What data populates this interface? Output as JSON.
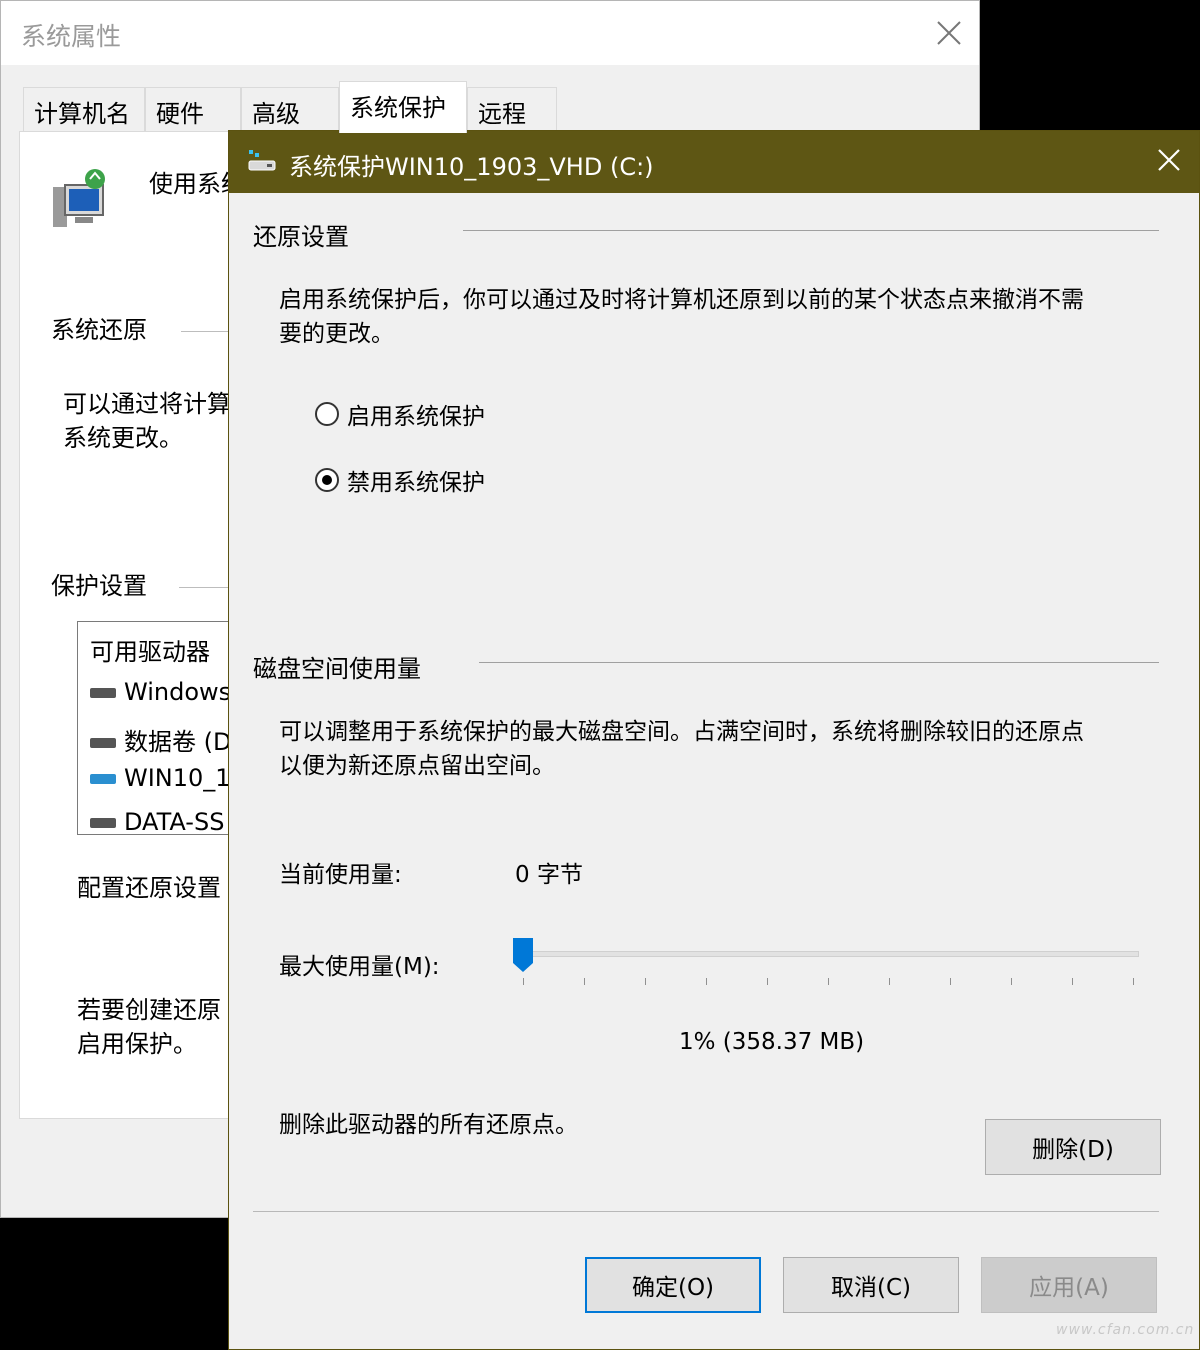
{
  "back_window": {
    "title": "系统属性",
    "tabs": [
      "计算机名",
      "硬件",
      "高级",
      "系统保护",
      "远程"
    ],
    "active_tab": "系统保护",
    "intro_text": "使用系统",
    "system_restore_label": "系统还原",
    "system_restore_desc": "可以通过将计算\n系统更改。",
    "protection_settings_label": "保护设置",
    "drive_list": {
      "header": "可用驱动器",
      "items": [
        "Windows",
        "数据卷 (D",
        "WIN10_1",
        "DATA-SS"
      ]
    },
    "configure_text": "配置还原设置",
    "create_text": "若要创建还原\n启用保护。"
  },
  "dialog": {
    "title": "系统保护WIN10_1903_VHD (C:)",
    "restore_settings": {
      "label": "还原设置",
      "description": "启用系统保护后，你可以通过及时将计算机还原到以前的某个状态点来撤消不需\n要的更改。",
      "options": [
        {
          "label": "启用系统保护",
          "checked": false
        },
        {
          "label": "禁用系统保护",
          "checked": true
        }
      ]
    },
    "disk_usage": {
      "label": "磁盘空间使用量",
      "description": "可以调整用于系统保护的最大磁盘空间。占满空间时，系统将删除较旧的还原点\n以便为新还原点留出空间。",
      "current_usage_label": "当前使用量:",
      "current_usage_value": "0 字节",
      "max_usage_label": "最大使用量(M):",
      "slider_percent": 1,
      "max_usage_value": "1% (358.37 MB)",
      "delete_text": "删除此驱动器的所有还原点。",
      "delete_button": "删除(D)"
    },
    "buttons": {
      "ok": "确定(O)",
      "cancel": "取消(C)",
      "apply": "应用(A)"
    }
  },
  "watermark": "www.cfan.com.cn",
  "colors": {
    "dialog_titlebar": "#5e5614",
    "accent": "#0078d7"
  }
}
